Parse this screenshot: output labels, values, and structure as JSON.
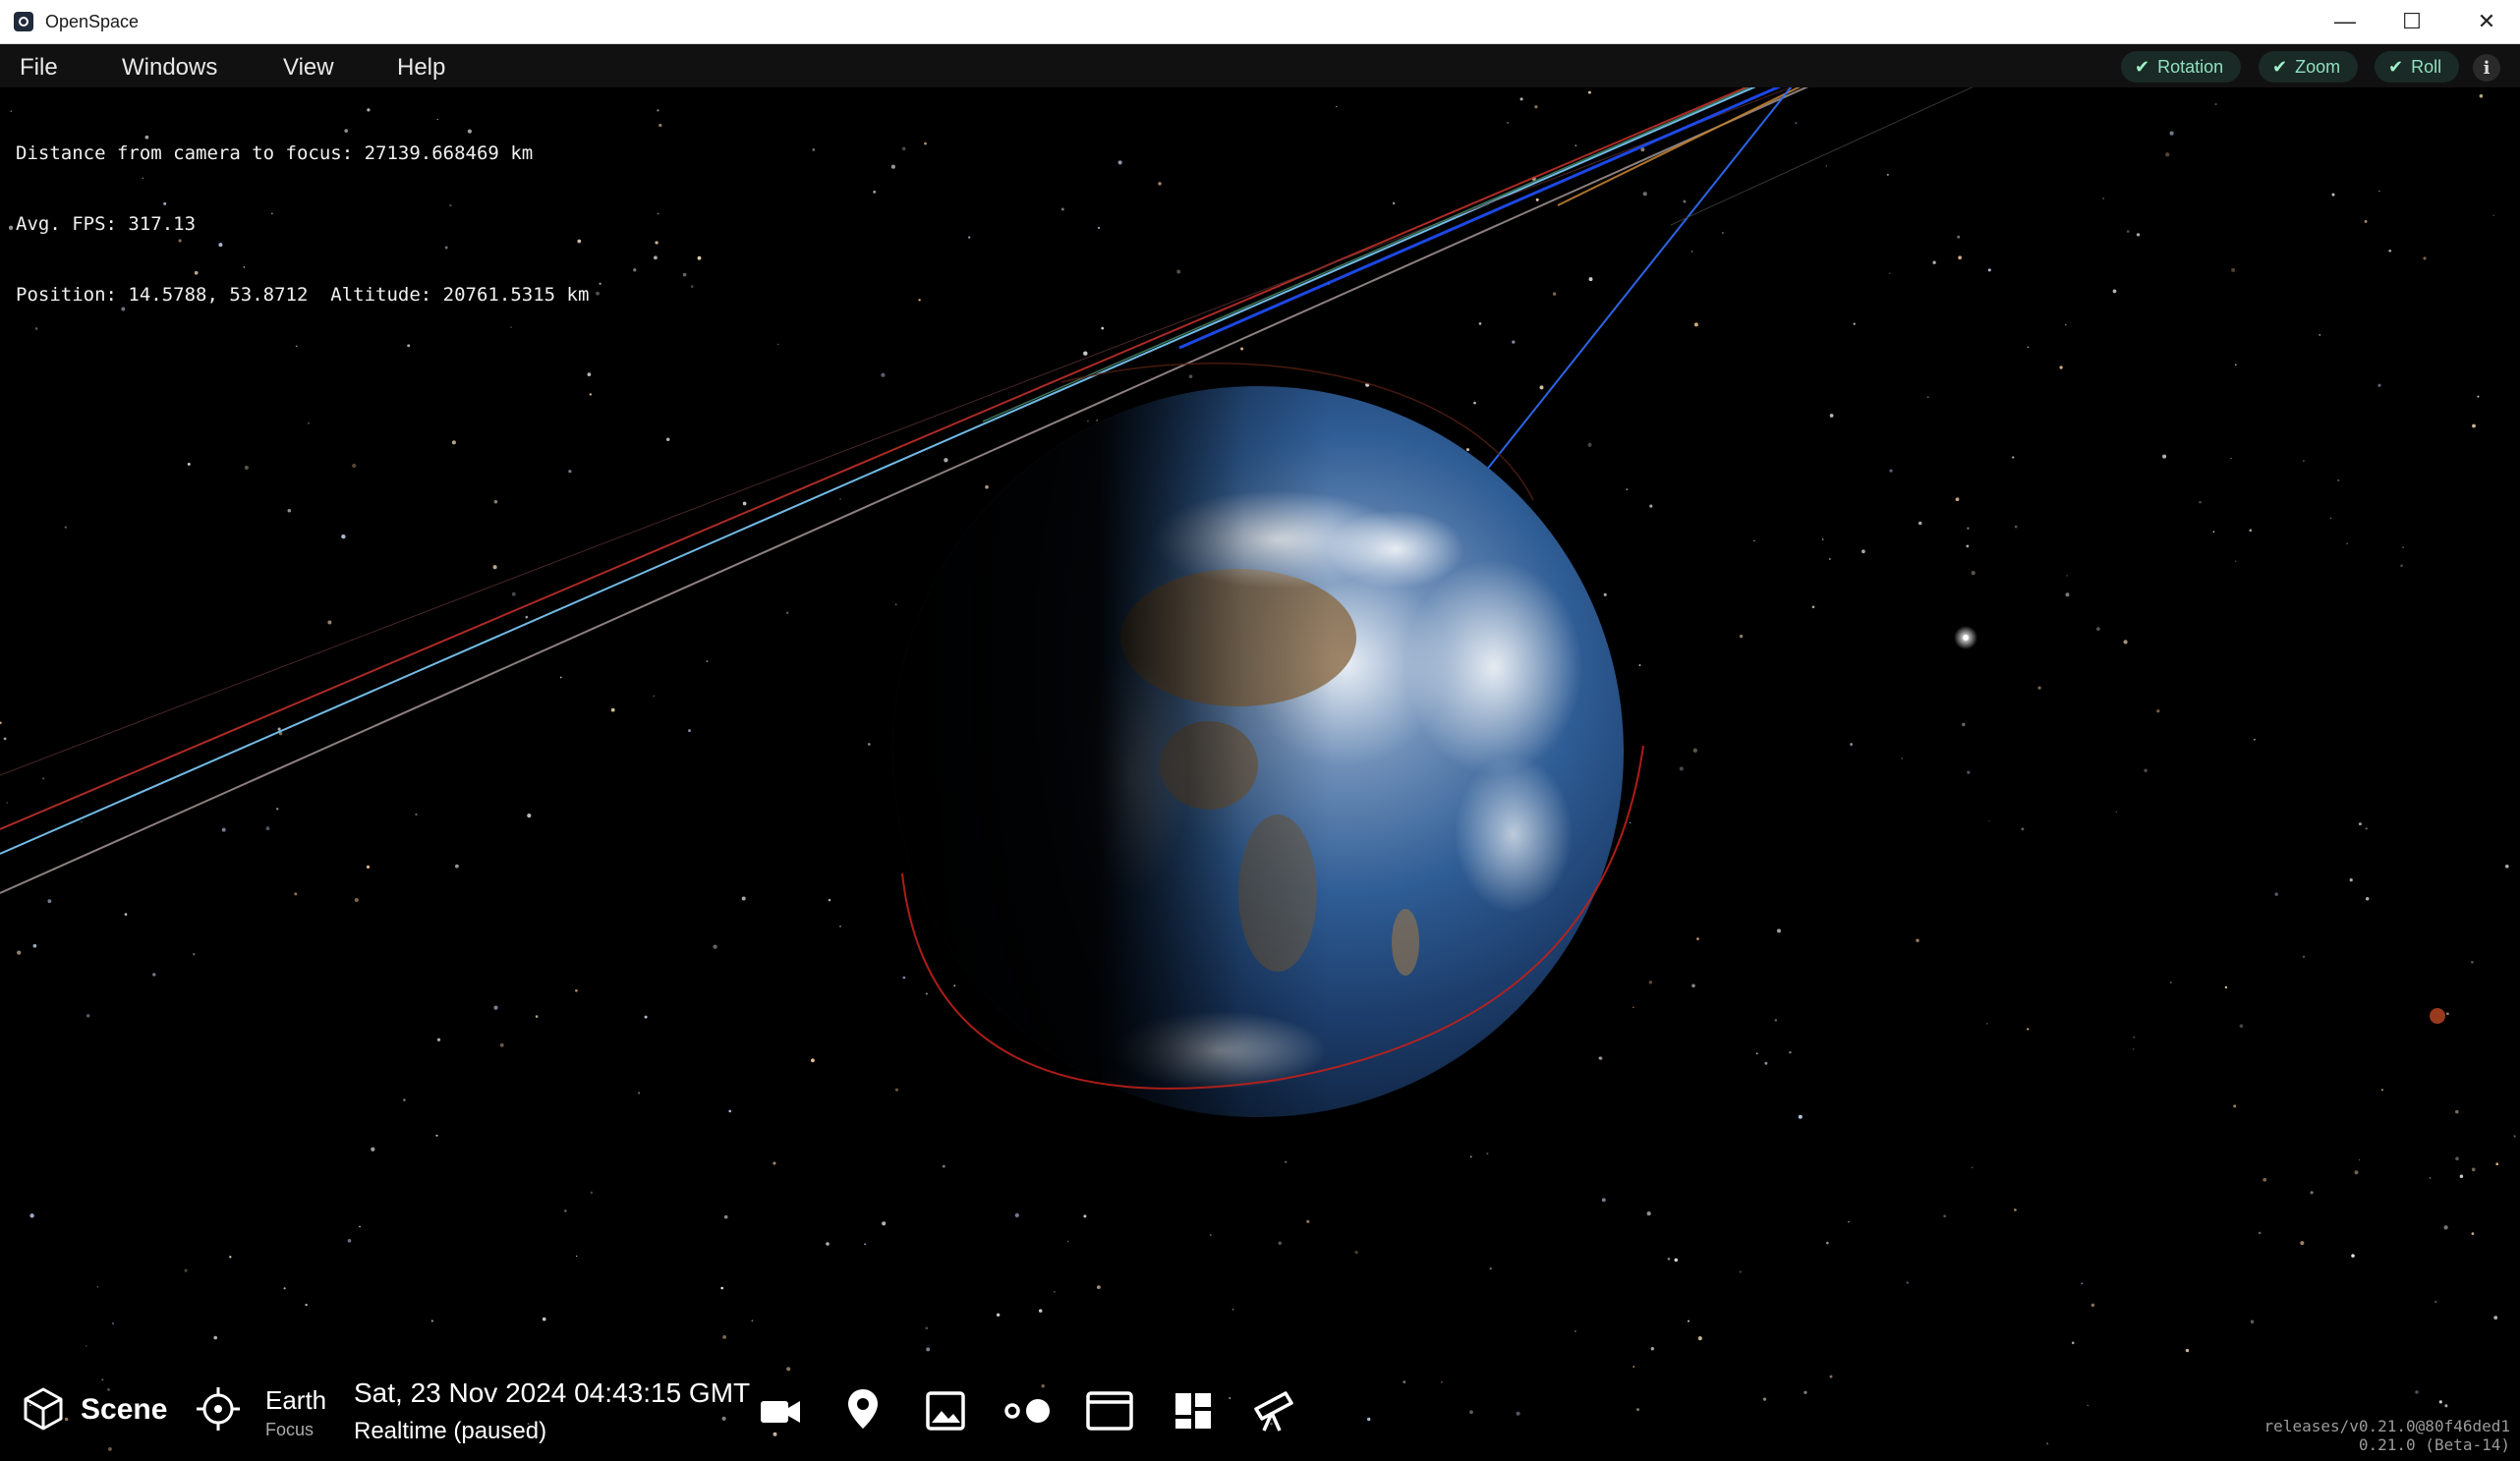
{
  "window": {
    "title": "OpenSpace",
    "minimize_glyph": "—",
    "maximize_glyph": "☐",
    "close_glyph": "✕"
  },
  "menu": {
    "items": [
      {
        "label": "File"
      },
      {
        "label": "Windows"
      },
      {
        "label": "View"
      },
      {
        "label": "Help"
      }
    ]
  },
  "toggles": [
    {
      "label": "Rotation",
      "checked": true
    },
    {
      "label": "Zoom",
      "checked": true
    },
    {
      "label": "Roll",
      "checked": true
    }
  ],
  "info_glyph": "i",
  "hud": {
    "distance": "Distance from camera to focus: 27139.668469 km",
    "fps": "Avg. FPS: 317.13",
    "position": "Position: 14.5788, 53.8712  Altitude: 20761.5315 km"
  },
  "bottom": {
    "scene_label": "Scene",
    "focus_name": "Earth",
    "focus_sub": "Focus",
    "date": "Sat, 23 Nov 2024 04:43:15 GMT",
    "time_mode": "Realtime (paused)",
    "icons": [
      "camera-icon",
      "location-pin-icon",
      "image-icon",
      "dots-icon",
      "window-icon",
      "dashboard-icon",
      "telescope-icon"
    ]
  },
  "version": {
    "line1": "releases/v0.21.0@80f46ded1",
    "line2": "0.21.0 (Beta-14)"
  },
  "colors": {
    "toggle_accent": "#8fe0c0",
    "menubar_bg": "#111111",
    "space_bg": "#000000"
  }
}
